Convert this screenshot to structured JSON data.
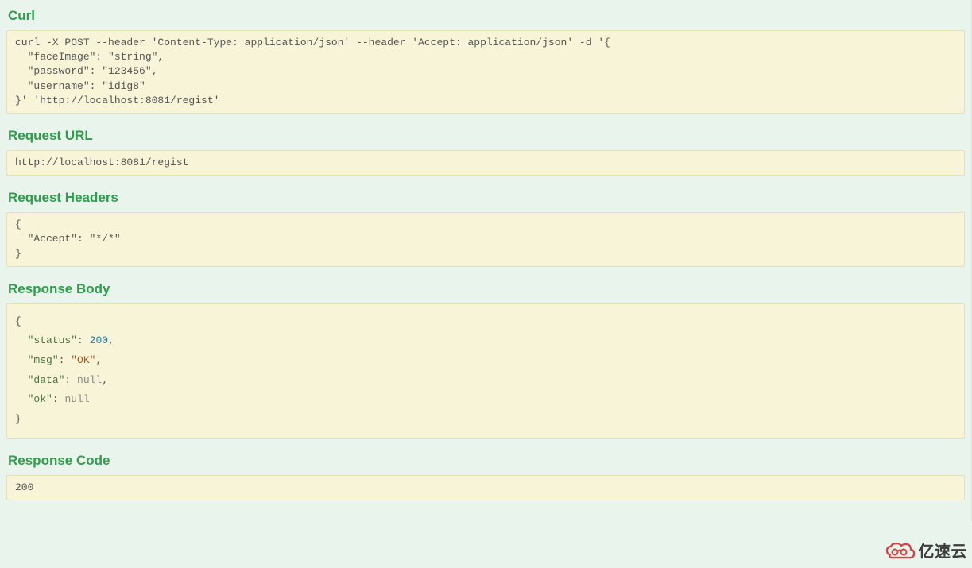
{
  "sections": {
    "curl": {
      "title": "Curl",
      "content": "curl -X POST --header 'Content-Type: application/json' --header 'Accept: application/json' -d '{\n  \"faceImage\": \"string\",\n  \"password\": \"123456\",\n  \"username\": \"idig8\"\n}' 'http://localhost:8081/regist'"
    },
    "request_url": {
      "title": "Request URL",
      "content": "http://localhost:8081/regist"
    },
    "request_headers": {
      "title": "Request Headers",
      "content": "{\n  \"Accept\": \"*/*\"\n}"
    },
    "response_body": {
      "title": "Response Body",
      "json": {
        "status": 200,
        "msg": "OK",
        "data": null,
        "ok": null
      }
    },
    "response_code": {
      "title": "Response Code",
      "content": "200"
    }
  },
  "watermark": {
    "text": "亿速云"
  }
}
